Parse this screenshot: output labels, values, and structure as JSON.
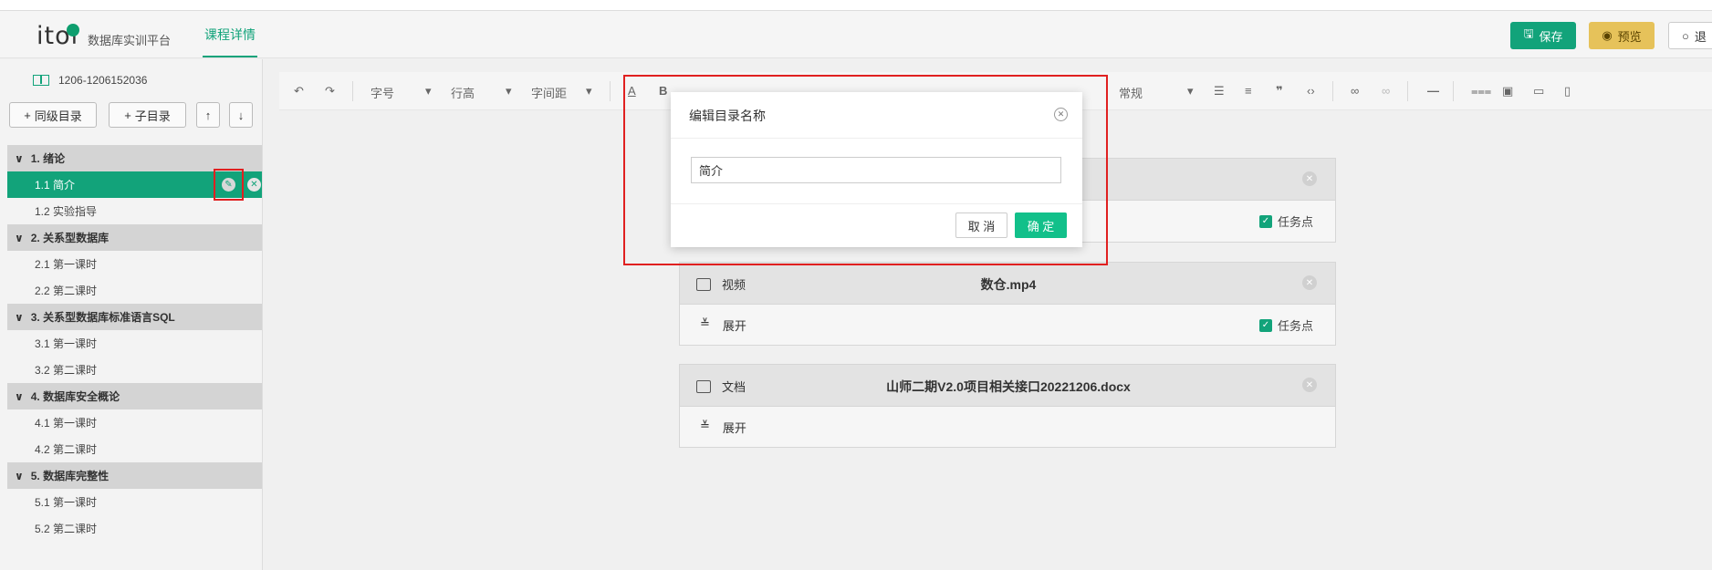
{
  "header": {
    "logo": "itol",
    "platform": "数据库实训平台",
    "tab": "课程详情",
    "save": "保存",
    "preview": "预览",
    "exit": "退"
  },
  "sidebar": {
    "course_id": "1206-1206152036",
    "add_sibling": "同级目录",
    "add_child": "子目录",
    "chapters": [
      {
        "title": "1. 绪论",
        "lessons": [
          "1.1 简介",
          "1.2 实验指导"
        ]
      },
      {
        "title": "2. 关系型数据库",
        "lessons": [
          "2.1 第一课时",
          "2.2 第二课时"
        ]
      },
      {
        "title": "3. 关系型数据库标准语言SQL",
        "lessons": [
          "3.1 第一课时",
          "3.2 第二课时"
        ]
      },
      {
        "title": "4. 数据库安全概论",
        "lessons": [
          "4.1 第一课时",
          "4.2 第二课时"
        ]
      },
      {
        "title": "5. 数据库完整性",
        "lessons": [
          "5.1 第一课时",
          "5.2 第二课时"
        ]
      }
    ]
  },
  "toolbar": {
    "font_size": "字号",
    "line_height": "行高",
    "letter_spacing": "字间距",
    "paragraph": "常规"
  },
  "cards": [
    {
      "type": "视频",
      "file": "数仓.mp4",
      "expand": "展开",
      "task": "任务点"
    },
    {
      "type": "文档",
      "file": "山师二期V2.0项目相关接口20221206.docx",
      "expand": "展开"
    }
  ],
  "card0_task": "任务点",
  "modal": {
    "title": "编辑目录名称",
    "input_value": "简介",
    "cancel": "取 消",
    "ok": "确 定"
  },
  "colors": {
    "accent": "#12a37a",
    "preview": "#e6c25a",
    "highlight": "#e02020"
  }
}
